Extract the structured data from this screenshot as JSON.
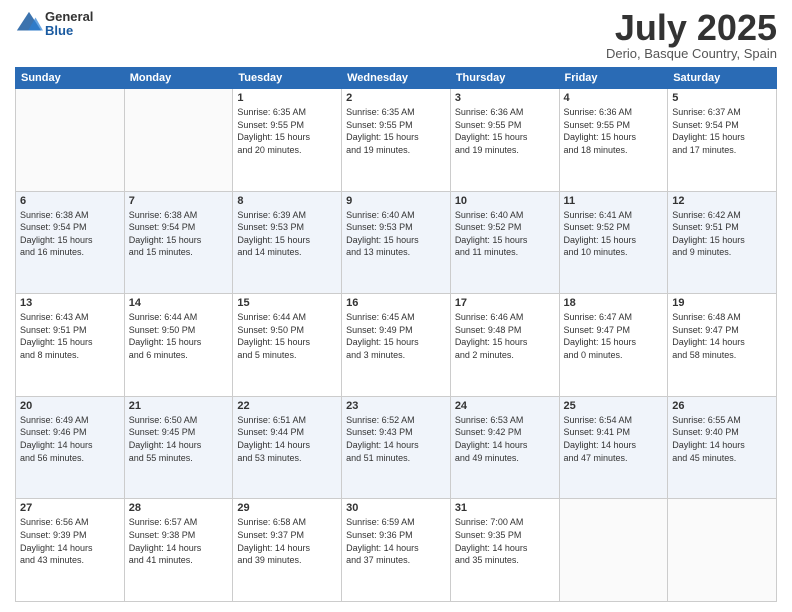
{
  "header": {
    "logo": {
      "general": "General",
      "blue": "Blue"
    },
    "title": "July 2025",
    "location": "Derio, Basque Country, Spain"
  },
  "calendar": {
    "headers": [
      "Sunday",
      "Monday",
      "Tuesday",
      "Wednesday",
      "Thursday",
      "Friday",
      "Saturday"
    ],
    "weeks": [
      [
        {
          "day": "",
          "info": ""
        },
        {
          "day": "",
          "info": ""
        },
        {
          "day": "1",
          "info": "Sunrise: 6:35 AM\nSunset: 9:55 PM\nDaylight: 15 hours\nand 20 minutes."
        },
        {
          "day": "2",
          "info": "Sunrise: 6:35 AM\nSunset: 9:55 PM\nDaylight: 15 hours\nand 19 minutes."
        },
        {
          "day": "3",
          "info": "Sunrise: 6:36 AM\nSunset: 9:55 PM\nDaylight: 15 hours\nand 19 minutes."
        },
        {
          "day": "4",
          "info": "Sunrise: 6:36 AM\nSunset: 9:55 PM\nDaylight: 15 hours\nand 18 minutes."
        },
        {
          "day": "5",
          "info": "Sunrise: 6:37 AM\nSunset: 9:54 PM\nDaylight: 15 hours\nand 17 minutes."
        }
      ],
      [
        {
          "day": "6",
          "info": "Sunrise: 6:38 AM\nSunset: 9:54 PM\nDaylight: 15 hours\nand 16 minutes."
        },
        {
          "day": "7",
          "info": "Sunrise: 6:38 AM\nSunset: 9:54 PM\nDaylight: 15 hours\nand 15 minutes."
        },
        {
          "day": "8",
          "info": "Sunrise: 6:39 AM\nSunset: 9:53 PM\nDaylight: 15 hours\nand 14 minutes."
        },
        {
          "day": "9",
          "info": "Sunrise: 6:40 AM\nSunset: 9:53 PM\nDaylight: 15 hours\nand 13 minutes."
        },
        {
          "day": "10",
          "info": "Sunrise: 6:40 AM\nSunset: 9:52 PM\nDaylight: 15 hours\nand 11 minutes."
        },
        {
          "day": "11",
          "info": "Sunrise: 6:41 AM\nSunset: 9:52 PM\nDaylight: 15 hours\nand 10 minutes."
        },
        {
          "day": "12",
          "info": "Sunrise: 6:42 AM\nSunset: 9:51 PM\nDaylight: 15 hours\nand 9 minutes."
        }
      ],
      [
        {
          "day": "13",
          "info": "Sunrise: 6:43 AM\nSunset: 9:51 PM\nDaylight: 15 hours\nand 8 minutes."
        },
        {
          "day": "14",
          "info": "Sunrise: 6:44 AM\nSunset: 9:50 PM\nDaylight: 15 hours\nand 6 minutes."
        },
        {
          "day": "15",
          "info": "Sunrise: 6:44 AM\nSunset: 9:50 PM\nDaylight: 15 hours\nand 5 minutes."
        },
        {
          "day": "16",
          "info": "Sunrise: 6:45 AM\nSunset: 9:49 PM\nDaylight: 15 hours\nand 3 minutes."
        },
        {
          "day": "17",
          "info": "Sunrise: 6:46 AM\nSunset: 9:48 PM\nDaylight: 15 hours\nand 2 minutes."
        },
        {
          "day": "18",
          "info": "Sunrise: 6:47 AM\nSunset: 9:47 PM\nDaylight: 15 hours\nand 0 minutes."
        },
        {
          "day": "19",
          "info": "Sunrise: 6:48 AM\nSunset: 9:47 PM\nDaylight: 14 hours\nand 58 minutes."
        }
      ],
      [
        {
          "day": "20",
          "info": "Sunrise: 6:49 AM\nSunset: 9:46 PM\nDaylight: 14 hours\nand 56 minutes."
        },
        {
          "day": "21",
          "info": "Sunrise: 6:50 AM\nSunset: 9:45 PM\nDaylight: 14 hours\nand 55 minutes."
        },
        {
          "day": "22",
          "info": "Sunrise: 6:51 AM\nSunset: 9:44 PM\nDaylight: 14 hours\nand 53 minutes."
        },
        {
          "day": "23",
          "info": "Sunrise: 6:52 AM\nSunset: 9:43 PM\nDaylight: 14 hours\nand 51 minutes."
        },
        {
          "day": "24",
          "info": "Sunrise: 6:53 AM\nSunset: 9:42 PM\nDaylight: 14 hours\nand 49 minutes."
        },
        {
          "day": "25",
          "info": "Sunrise: 6:54 AM\nSunset: 9:41 PM\nDaylight: 14 hours\nand 47 minutes."
        },
        {
          "day": "26",
          "info": "Sunrise: 6:55 AM\nSunset: 9:40 PM\nDaylight: 14 hours\nand 45 minutes."
        }
      ],
      [
        {
          "day": "27",
          "info": "Sunrise: 6:56 AM\nSunset: 9:39 PM\nDaylight: 14 hours\nand 43 minutes."
        },
        {
          "day": "28",
          "info": "Sunrise: 6:57 AM\nSunset: 9:38 PM\nDaylight: 14 hours\nand 41 minutes."
        },
        {
          "day": "29",
          "info": "Sunrise: 6:58 AM\nSunset: 9:37 PM\nDaylight: 14 hours\nand 39 minutes."
        },
        {
          "day": "30",
          "info": "Sunrise: 6:59 AM\nSunset: 9:36 PM\nDaylight: 14 hours\nand 37 minutes."
        },
        {
          "day": "31",
          "info": "Sunrise: 7:00 AM\nSunset: 9:35 PM\nDaylight: 14 hours\nand 35 minutes."
        },
        {
          "day": "",
          "info": ""
        },
        {
          "day": "",
          "info": ""
        }
      ]
    ]
  }
}
